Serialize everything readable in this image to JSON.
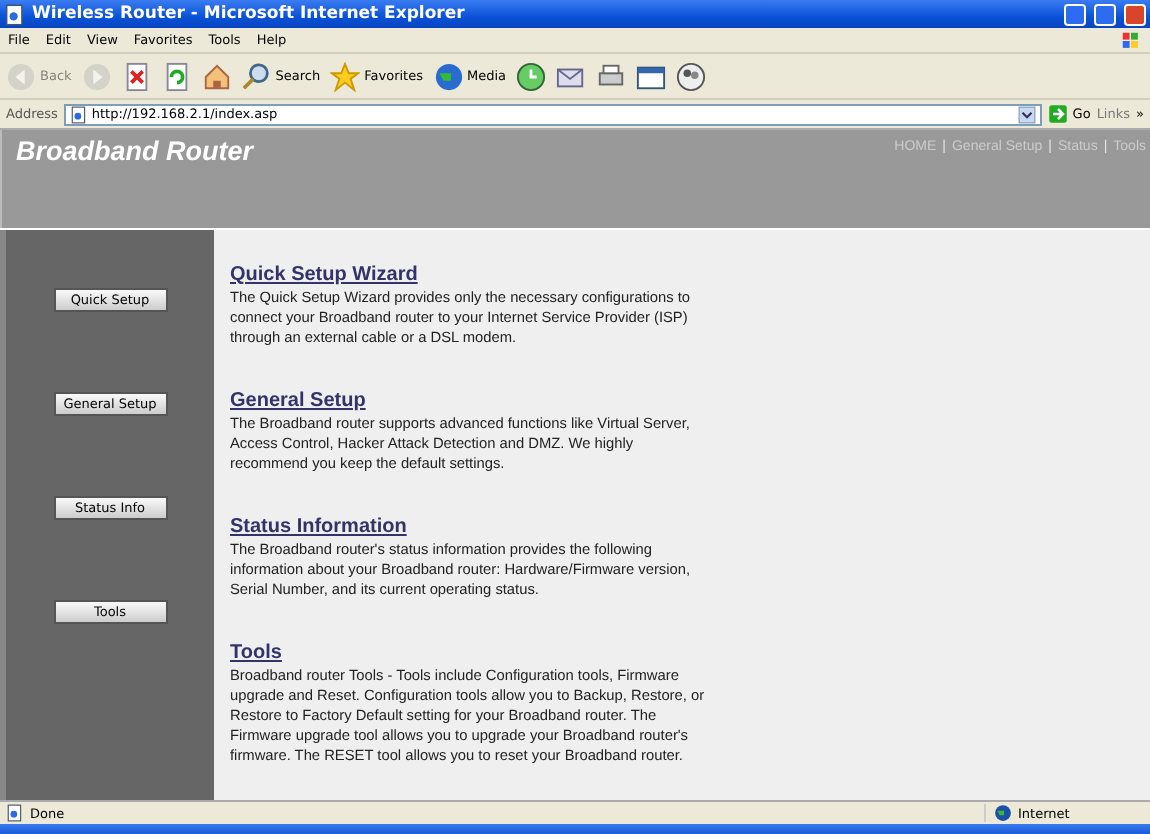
{
  "window": {
    "title": "Wireless Router - Microsoft Internet Explorer"
  },
  "menu": [
    "File",
    "Edit",
    "View",
    "Favorites",
    "Tools",
    "Help"
  ],
  "toolbar": [
    {
      "kind": "back",
      "label": "Back",
      "disabled": true
    },
    {
      "kind": "forward",
      "disabled": true
    },
    {
      "kind": "stop"
    },
    {
      "kind": "refresh"
    },
    {
      "kind": "home"
    },
    {
      "kind": "search",
      "label": "Search"
    },
    {
      "kind": "favorites",
      "label": "Favorites"
    },
    {
      "kind": "media",
      "label": "Media"
    },
    {
      "kind": "history"
    },
    {
      "kind": "mail"
    },
    {
      "kind": "print"
    },
    {
      "kind": "edit"
    },
    {
      "kind": "messenger"
    }
  ],
  "address": {
    "label": "Address",
    "value": "http://192.168.2.1/index.asp",
    "go": "Go",
    "links": "Links",
    "more": "»"
  },
  "header": {
    "title": "Broadband Router",
    "nav": [
      {
        "kind": "link",
        "text": "HOME"
      },
      {
        "kind": "sep",
        "text": "|"
      },
      {
        "kind": "link",
        "text": "General Setup"
      },
      {
        "kind": "sep",
        "text": "|"
      },
      {
        "kind": "link",
        "text": "Status"
      },
      {
        "kind": "sep",
        "text": "|"
      },
      {
        "kind": "link",
        "text": "Tools"
      }
    ]
  },
  "sidebar": {
    "buttons": [
      "Quick Setup",
      "General Setup",
      "Status Info",
      "Tools"
    ]
  },
  "sections": [
    {
      "title": "Quick Setup Wizard",
      "text": "The Quick Setup Wizard provides only the necessary configurations to connect your Broadband router to your Internet Service Provider (ISP) through an external cable or a DSL modem."
    },
    {
      "title": "General Setup",
      "text": "The Broadband router supports advanced functions like Virtual Server, Access Control, Hacker Attack Detection and DMZ. We highly recommend you keep the default settings."
    },
    {
      "title": "Status Information",
      "text": "The Broadband router's status information provides the following information about your Broadband router: Hardware/Firmware version, Serial Number, and its current operating status."
    },
    {
      "title": "Tools",
      "text": "Broadband router Tools - Tools include Configuration tools, Firmware upgrade and Reset. Configuration tools allow you to Backup, Restore, or Restore to Factory Default setting for your Broadband router. The Firmware upgrade tool allows you to upgrade your Broadband router's firmware. The RESET tool allows you to reset your Broadband router."
    }
  ],
  "status_bar": {
    "text": "Done",
    "zone": "Internet"
  }
}
